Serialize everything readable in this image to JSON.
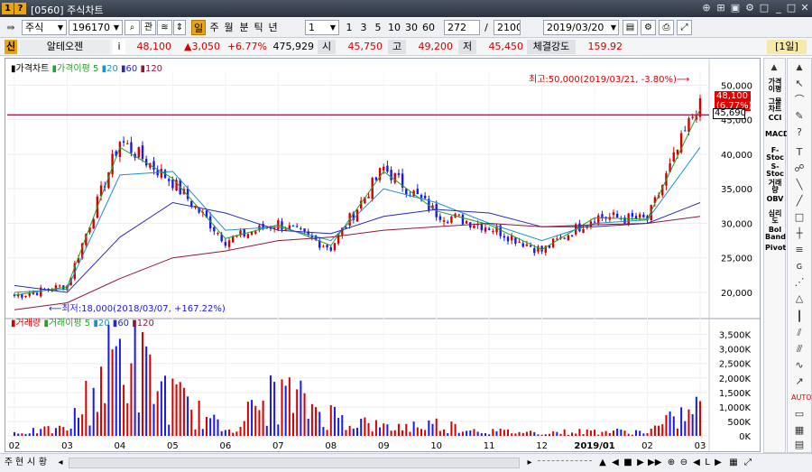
{
  "window": {
    "code": "[0560]",
    "title": "주식차트"
  },
  "toolbar": {
    "market": "주식",
    "stock_code": "196170",
    "relation_label": "관",
    "periods": [
      "일",
      "주",
      "월",
      "분",
      "틱",
      "년"
    ],
    "period_value": "1",
    "intervals": [
      "1",
      "3",
      "5",
      "10",
      "30",
      "60"
    ],
    "count": "272",
    "total": "2100",
    "date": "2019/03/20"
  },
  "quote": {
    "name": "알테오젠",
    "price": "48,100",
    "change": "▲3,050",
    "change_pct": "+6.77%",
    "volume": "475,929",
    "open_label": "시",
    "open": "45,750",
    "high_label": "고",
    "high": "49,200",
    "low_label": "저",
    "low": "45,450",
    "strength_label": "체결강도",
    "strength": "159.92",
    "mode_badge": "[1일]"
  },
  "price_panel": {
    "legend_title": "가격차트",
    "legend_ma": "가격이평 5",
    "legend_ma_periods": [
      "20",
      "60",
      "120"
    ],
    "y_ticks": [
      "50,000",
      "45,000",
      "40,000",
      "35,000",
      "30,000",
      "25,000",
      "20,000"
    ],
    "current_label": "48,100",
    "current_pct_label": "(6.77%)",
    "line_label": "45,690",
    "high_note": "최고:50,000(2019/03/21, -3.80%)⟶",
    "low_note": "⟵최저:18,000(2018/03/07, +167.22%)"
  },
  "volume_panel": {
    "legend_title": "거래량",
    "legend_ma": "거래이평 5",
    "legend_ma_periods": [
      "20",
      "60",
      "120"
    ],
    "y_ticks": [
      "3,500K",
      "3,000K",
      "2,500K",
      "2,000K",
      "1,500K",
      "1,000K",
      "500K",
      "0K"
    ]
  },
  "x_axis": [
    "02",
    "03",
    "04",
    "05",
    "06",
    "07",
    "08",
    "09",
    "10",
    "11",
    "12",
    "2019/01",
    "02",
    "03"
  ],
  "sidebar_indicators": [
    "가격이평",
    "그물차트",
    "CCI",
    "MACD",
    "F-Stoc",
    "S-Stoc",
    "거래량",
    "OBV",
    "심리도",
    "Bol Band",
    "Pivot"
  ],
  "bottom": {
    "tabs": [
      "주",
      "현",
      "시",
      "황"
    ]
  },
  "colors": {
    "up": "#d40000",
    "down": "#1a1ae6",
    "ma5": "#2a9d2a",
    "ma20": "#1e90c8",
    "ma60": "#2a2ab4",
    "ma120": "#8b1a3a",
    "hline": "#e0006a"
  },
  "chart_data": [
    {
      "type": "candlestick",
      "title": "가격차트",
      "x": [
        "2018-02",
        "2018-03",
        "2018-04",
        "2018-05",
        "2018-06",
        "2018-07",
        "2018-08",
        "2018-09",
        "2018-10",
        "2018-11",
        "2018-12",
        "2019-01",
        "2019-02",
        "2019-03"
      ],
      "series": [
        {
          "name": "가격차트",
          "close": [
            19500,
            21000,
            42000,
            36000,
            27500,
            30000,
            26500,
            38000,
            31500,
            29500,
            26000,
            31000,
            30500,
            48100
          ]
        },
        {
          "name": "5",
          "values": [
            19600,
            20800,
            41000,
            36500,
            27800,
            29800,
            26800,
            37500,
            31800,
            29800,
            26200,
            30800,
            30600,
            46500
          ]
        },
        {
          "name": "20",
          "values": [
            20000,
            20500,
            37000,
            37500,
            29000,
            29500,
            27500,
            35000,
            33000,
            30000,
            27500,
            30000,
            30500,
            41000
          ]
        },
        {
          "name": "60",
          "values": [
            21000,
            20000,
            28000,
            33000,
            31500,
            29000,
            28500,
            31000,
            32000,
            31500,
            29500,
            29500,
            30000,
            33000
          ]
        },
        {
          "name": "120",
          "values": [
            17500,
            18500,
            22000,
            25000,
            26000,
            27500,
            28000,
            29000,
            29500,
            30000,
            29500,
            29800,
            30000,
            31000
          ]
        }
      ],
      "y_range": [
        17000,
        52000
      ],
      "horizontal_line": 45690,
      "max": {
        "value": 50000,
        "date": "2019/03/21"
      },
      "min": {
        "value": 18000,
        "date": "2018/03/07"
      }
    },
    {
      "type": "bar",
      "title": "거래량",
      "x": [
        "2018-02",
        "2018-03",
        "2018-04",
        "2018-05",
        "2018-06",
        "2018-07",
        "2018-08",
        "2018-09",
        "2018-10",
        "2018-11",
        "2018-12",
        "2019-01",
        "2019-02",
        "2019-03"
      ],
      "series": [
        {
          "name": "거래량",
          "values": [
            150,
            300,
            3600,
            1600,
            250,
            1800,
            900,
            350,
            500,
            200,
            150,
            200,
            180,
            1200
          ]
        }
      ],
      "unit": "K",
      "y_range": [
        0,
        3800
      ]
    }
  ]
}
